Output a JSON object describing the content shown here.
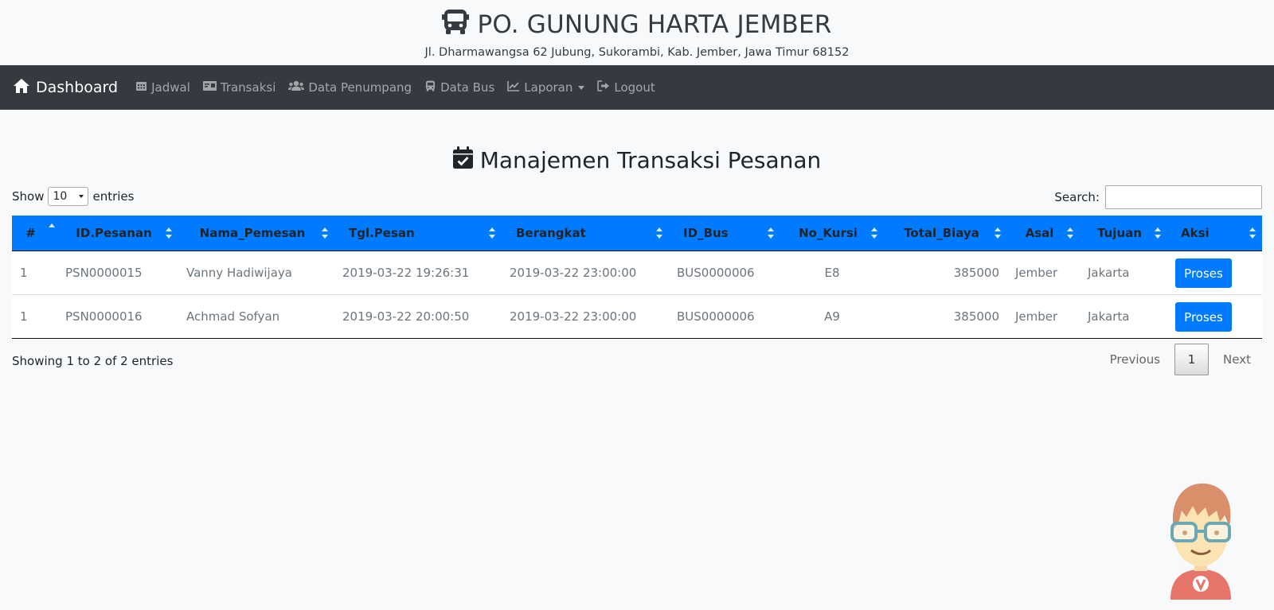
{
  "header": {
    "title": "PO. GUNUNG HARTA JEMBER",
    "address": "Jl. Dharmawangsa 62 Jubung, Sukorambi, Kab. Jember, Jawa Timur 68152",
    "icon": "bus-icon"
  },
  "navbar": {
    "brand": "Dashboard",
    "items": [
      {
        "label": "Jadwal",
        "icon": "calendar-icon"
      },
      {
        "label": "Transaksi",
        "icon": "money-bill-icon"
      },
      {
        "label": "Data Penumpang",
        "icon": "users-icon"
      },
      {
        "label": "Data Bus",
        "icon": "bus-icon"
      },
      {
        "label": "Laporan",
        "icon": "chart-line-icon"
      },
      {
        "label": "Logout",
        "icon": "sign-out-icon"
      }
    ]
  },
  "page": {
    "title": "Manajemen Transaksi Pesanan",
    "icon": "calendar-check-icon"
  },
  "length": {
    "show_label": "Show",
    "value": "10",
    "entries_label": "entries"
  },
  "search": {
    "label": "Search:",
    "value": ""
  },
  "table": {
    "columns": [
      "#",
      "ID.Pesanan",
      "Nama_Pemesan",
      "Tgl.Pesan",
      "Berangkat",
      "ID_Bus",
      "No_Kursi",
      "Total_Biaya",
      "Asal",
      "Tujuan",
      "Aksi"
    ],
    "rows": [
      {
        "no": "1",
        "id": "PSN0000015",
        "nama": "Vanny Hadiwijaya",
        "tgl": "2019-03-22 19:26:31",
        "berangkat": "2019-03-22 23:00:00",
        "bus": "BUS0000006",
        "kursi": "E8",
        "biaya": "385000",
        "asal": "Jember",
        "tujuan": "Jakarta",
        "aksi": "Proses"
      },
      {
        "no": "1",
        "id": "PSN0000016",
        "nama": "Achmad Sofyan",
        "tgl": "2019-03-22 20:00:50",
        "berangkat": "2019-03-22 23:00:00",
        "bus": "BUS0000006",
        "kursi": "A9",
        "biaya": "385000",
        "asal": "Jember",
        "tujuan": "Jakarta",
        "aksi": "Proses"
      }
    ]
  },
  "footer": {
    "info": "Showing 1 to 2 of 2 entries",
    "previous": "Previous",
    "current_page": "1",
    "next": "Next"
  },
  "colors": {
    "navbar_bg": "#343a40",
    "table_header_bg": "#007bff",
    "button_primary": "#007bff",
    "page_bg": "#f8f9fa"
  }
}
